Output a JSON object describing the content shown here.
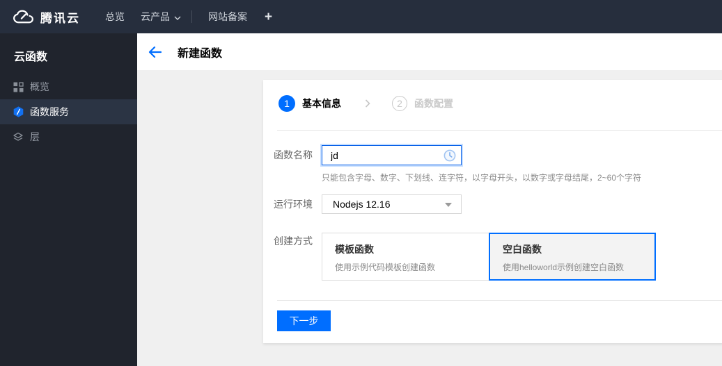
{
  "topbar": {
    "logo_text": "腾讯云",
    "nav_overview": "总览",
    "nav_products": "云产品",
    "nav_icp": "网站备案",
    "plus": "+"
  },
  "sidebar": {
    "title": "云函数",
    "items": [
      {
        "label": "概览",
        "icon": "grid-icon",
        "selected": false
      },
      {
        "label": "函数服务",
        "icon": "scf-hexagon-icon",
        "selected": true
      },
      {
        "label": "层",
        "icon": "layers-icon",
        "selected": false
      }
    ]
  },
  "header": {
    "title": "新建函数"
  },
  "wizard": {
    "steps": [
      {
        "number": "1",
        "label": "基本信息",
        "active": true
      },
      {
        "number": "2",
        "label": "函数配置",
        "active": false
      }
    ],
    "form": {
      "name": {
        "label": "函数名称",
        "value": "jd",
        "help": "只能包含字母、数字、下划线、连字符，以字母开头，以数字或字母结尾，2~60个字符"
      },
      "runtime": {
        "label": "运行环境",
        "value": "Nodejs 12.16"
      },
      "method": {
        "label": "创建方式",
        "options": [
          {
            "title": "模板函数",
            "desc": "使用示例代码模板创建函数",
            "selected": false
          },
          {
            "title": "空白函数",
            "desc": "使用helloworld示例创建空白函数",
            "selected": true
          }
        ]
      }
    },
    "next_button": "下一步"
  },
  "colors": {
    "accent_blue": "#006eff",
    "topbar_bg": "#262e3d",
    "sidebar_bg": "#20242d",
    "sidebar_selected_bg": "#2b3444",
    "content_bg": "#f0f0f0",
    "selected_card_bg": "#f3f3f3",
    "focus_border": "#0a62e8"
  }
}
